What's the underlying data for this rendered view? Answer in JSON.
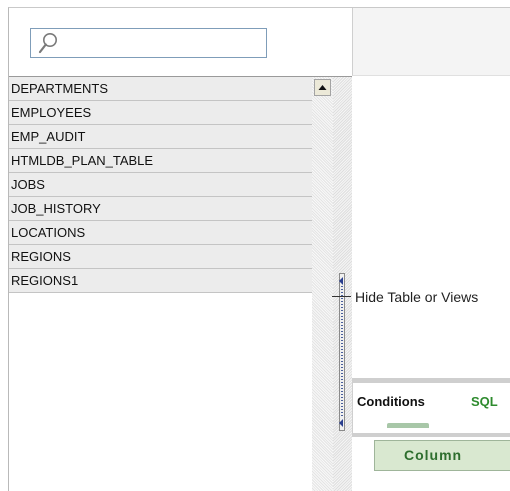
{
  "search": {
    "value": "",
    "placeholder": ""
  },
  "tables": [
    {
      "label": "DEPARTMENTS"
    },
    {
      "label": "EMPLOYEES"
    },
    {
      "label": "EMP_AUDIT"
    },
    {
      "label": "HTMLDB_PLAN_TABLE"
    },
    {
      "label": "JOBS"
    },
    {
      "label": "JOB_HISTORY"
    },
    {
      "label": "LOCATIONS"
    },
    {
      "label": "REGIONS"
    },
    {
      "label": "REGIONS1"
    }
  ],
  "callout": {
    "text": "Hide Table or Views"
  },
  "tabs": [
    {
      "label": "Conditions",
      "selected": true
    },
    {
      "label": "SQL",
      "selected": false
    }
  ],
  "column_button": {
    "label": "Column"
  },
  "icons": {
    "search": "magnifier-icon",
    "scroll_up": "scroll-up-arrow-icon",
    "splitter": "collapse-left-icon"
  },
  "colors": {
    "tab_active": "#111111",
    "tab_inactive": "#2e8b2e",
    "button_bg": "#d9e8d0",
    "row_bg": "#ececec"
  }
}
